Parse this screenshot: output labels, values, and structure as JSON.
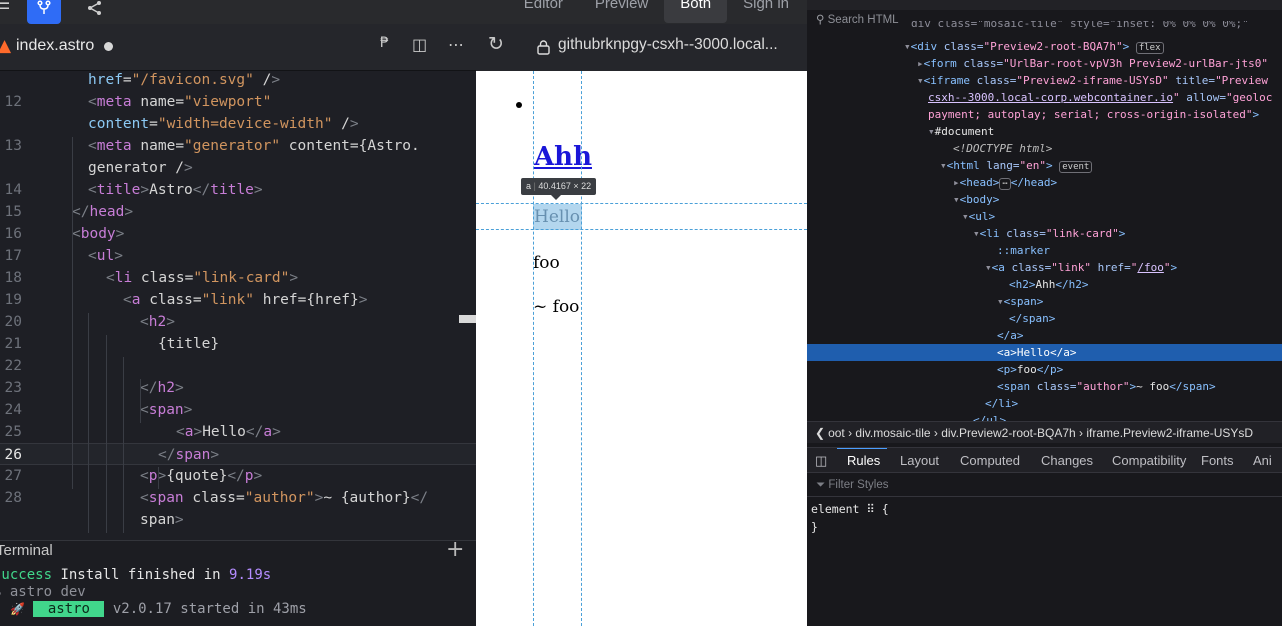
{
  "topbar": {
    "tabs": [
      {
        "label": "Editor",
        "active": false
      },
      {
        "label": "Preview",
        "active": false
      },
      {
        "label": "Both",
        "active": true
      },
      {
        "label": "Sign in",
        "active": false
      }
    ],
    "icons": [
      "menu-icon",
      "fork-icon",
      "share-icon"
    ]
  },
  "editor": {
    "filename": "index.astro",
    "modified": true,
    "lines": [
      {
        "num": "",
        "text": "href=\"/favicon.svg\" />"
      },
      {
        "num": "12",
        "text": "<meta name=\"viewport\""
      },
      {
        "num": "",
        "text": "content=\"width=device-width\" />"
      },
      {
        "num": "13",
        "text": "<meta name=\"generator\" content={Astro."
      },
      {
        "num": "",
        "text": "generator} />"
      },
      {
        "num": "14",
        "text": "<title>Astro</title>"
      },
      {
        "num": "15",
        "text": "</head>"
      },
      {
        "num": "16",
        "text": "<body>"
      },
      {
        "num": "17",
        "text": "<ul>"
      },
      {
        "num": "18",
        "text": "<li class=\"link-card\">"
      },
      {
        "num": "19",
        "text": "<a class=\"link\" href={href}>"
      },
      {
        "num": "20",
        "text": "<h2>"
      },
      {
        "num": "21",
        "text": "{title}"
      },
      {
        "num": "22",
        "text": ""
      },
      {
        "num": "23",
        "text": "</h2>"
      },
      {
        "num": "24",
        "text": "<span>"
      },
      {
        "num": "25",
        "text": "<a>Hello</a>"
      },
      {
        "num": "26",
        "text": "</span>"
      },
      {
        "num": "27",
        "text": "<p>{quote}</p>"
      },
      {
        "num": "28",
        "text": "<span class=\"author\">~ {author}</"
      },
      {
        "num": "",
        "text": "span>"
      },
      {
        "num": "29",
        "text": "</a>"
      }
    ]
  },
  "terminal": {
    "title": "Terminal",
    "lines": [
      {
        "prefix": "success",
        "text": " Install finished in ",
        "value": "9.19s"
      },
      {
        "prefix": "$",
        "text": " astro dev",
        "value": ""
      },
      {
        "prefix": "🚀",
        "badge": " astro ",
        "text": " v2.0.17 started in 43ms"
      }
    ]
  },
  "preview": {
    "url": "githubrknpgy-csxh--3000.local...",
    "heading": "Ahh",
    "hello": "Hello",
    "quote": "foo",
    "author": "~ foo",
    "tooltip_tag": "a",
    "tooltip_size": "40.4167 × 22"
  },
  "devtools": {
    "search_placeholder": "Search HTML",
    "breadcrumbs": "oot › div.mosaic-tile › div.Preview2-root-BQA7h › iframe.Preview2-iframe-USYsD",
    "panel_tabs": [
      "Rules",
      "Layout",
      "Computed",
      "Changes",
      "Compatibility",
      "Fonts",
      "Ani"
    ],
    "filter_placeholder": "Filter Styles",
    "rule_selector": "element ⠿ {",
    "rule_close": "}"
  }
}
